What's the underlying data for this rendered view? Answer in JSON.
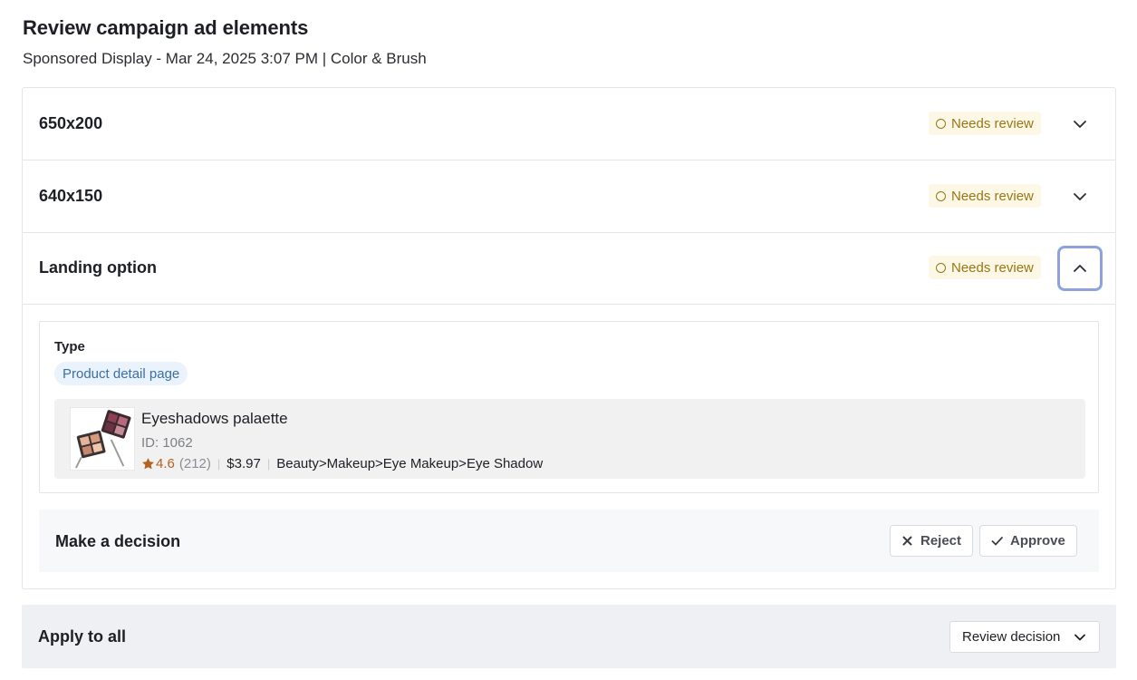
{
  "header": {
    "title": "Review campaign ad elements",
    "subtitle": "Sponsored Display - Mar 24, 2025 3:07 PM | Color & Brush"
  },
  "elements": [
    {
      "title": "650x200",
      "status": "Needs review",
      "expanded": false
    },
    {
      "title": "640x150",
      "status": "Needs review",
      "expanded": false
    },
    {
      "title": "Landing option",
      "status": "Needs review",
      "expanded": true
    }
  ],
  "landing": {
    "type_label": "Type",
    "type_value": "Product detail page",
    "product": {
      "name": "Eyeshadows palaette",
      "id": "ID: 1062",
      "rating": "4.6",
      "reviews": "(212)",
      "separator": "|",
      "price": "$3.97",
      "category": "Beauty>Makeup>Eye Makeup>Eye Shadow"
    }
  },
  "decision": {
    "title": "Make a decision",
    "reject_label": "Reject",
    "approve_label": "Approve"
  },
  "apply_all": {
    "title": "Apply to all",
    "select_label": "Review decision"
  },
  "colors": {
    "status_text": "#9a7514",
    "status_bg": "#fdf8e6",
    "chip_text": "#3c6fa6",
    "chip_bg": "#eaf2fb",
    "rating": "#b4621e",
    "focus_ring": "#8fa2dd"
  }
}
